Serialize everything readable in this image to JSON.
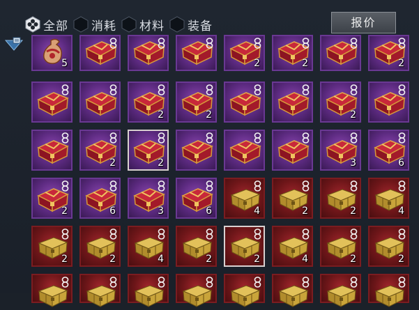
{
  "filters": [
    {
      "label": "全部",
      "selected": true
    },
    {
      "label": "消耗",
      "selected": false
    },
    {
      "label": "材料",
      "selected": false
    },
    {
      "label": "装备",
      "selected": false
    }
  ],
  "quote_button": "报价",
  "colors": {
    "purple_slot": "#5c2a80",
    "red_slot": "#6e1619",
    "gold_box": "#c9a43a"
  },
  "rows": [
    [
      {
        "item": "pouch",
        "rarity": "purple",
        "count": "5",
        "locked": false
      },
      {
        "item": "red-chest",
        "rarity": "purple",
        "count": "",
        "locked": true
      },
      {
        "item": "red-chest",
        "rarity": "purple",
        "count": "",
        "locked": true
      },
      {
        "item": "red-chest",
        "rarity": "purple",
        "count": "",
        "locked": true
      },
      {
        "item": "red-chest",
        "rarity": "purple",
        "count": "2",
        "locked": true
      },
      {
        "item": "red-chest",
        "rarity": "purple",
        "count": "2",
        "locked": true
      },
      {
        "item": "red-chest",
        "rarity": "purple",
        "count": "",
        "locked": true
      },
      {
        "item": "red-chest",
        "rarity": "purple",
        "count": "2",
        "locked": true
      }
    ],
    [
      {
        "item": "red-chest",
        "rarity": "purple",
        "count": "",
        "locked": true
      },
      {
        "item": "red-chest",
        "rarity": "purple",
        "count": "",
        "locked": true
      },
      {
        "item": "red-chest",
        "rarity": "purple",
        "count": "2",
        "locked": true
      },
      {
        "item": "red-chest",
        "rarity": "purple",
        "count": "2",
        "locked": true
      },
      {
        "item": "red-chest",
        "rarity": "purple",
        "count": "",
        "locked": true
      },
      {
        "item": "red-chest",
        "rarity": "purple",
        "count": "",
        "locked": true
      },
      {
        "item": "red-chest",
        "rarity": "purple",
        "count": "2",
        "locked": true
      },
      {
        "item": "red-chest",
        "rarity": "purple",
        "count": "",
        "locked": true
      }
    ],
    [
      {
        "item": "red-chest",
        "rarity": "purple",
        "count": "",
        "locked": true
      },
      {
        "item": "red-chest",
        "rarity": "purple",
        "count": "2",
        "locked": true
      },
      {
        "item": "red-chest",
        "rarity": "purple",
        "count": "2",
        "locked": true,
        "selected": true
      },
      {
        "item": "red-chest",
        "rarity": "purple",
        "count": "",
        "locked": true
      },
      {
        "item": "red-chest",
        "rarity": "purple",
        "count": "",
        "locked": true
      },
      {
        "item": "red-chest",
        "rarity": "purple",
        "count": "",
        "locked": true
      },
      {
        "item": "red-chest",
        "rarity": "purple",
        "count": "3",
        "locked": true
      },
      {
        "item": "red-chest",
        "rarity": "purple",
        "count": "6",
        "locked": true
      }
    ],
    [
      {
        "item": "red-chest",
        "rarity": "purple",
        "count": "2",
        "locked": true
      },
      {
        "item": "red-chest",
        "rarity": "purple",
        "count": "6",
        "locked": true
      },
      {
        "item": "red-chest",
        "rarity": "purple",
        "count": "3",
        "locked": true
      },
      {
        "item": "red-chest",
        "rarity": "purple",
        "count": "6",
        "locked": true
      },
      {
        "item": "gold-box",
        "rarity": "red",
        "count": "4",
        "locked": true
      },
      {
        "item": "gold-box",
        "rarity": "red",
        "count": "2",
        "locked": true
      },
      {
        "item": "gold-box",
        "rarity": "red",
        "count": "2",
        "locked": true
      },
      {
        "item": "gold-box",
        "rarity": "red",
        "count": "4",
        "locked": true
      }
    ],
    [
      {
        "item": "gold-box",
        "rarity": "red",
        "count": "2",
        "locked": true
      },
      {
        "item": "gold-box",
        "rarity": "red",
        "count": "2",
        "locked": true
      },
      {
        "item": "gold-box",
        "rarity": "red",
        "count": "4",
        "locked": true
      },
      {
        "item": "gold-box",
        "rarity": "red",
        "count": "2",
        "locked": true
      },
      {
        "item": "gold-box",
        "rarity": "red",
        "count": "2",
        "locked": true,
        "selected": true
      },
      {
        "item": "gold-box",
        "rarity": "red",
        "count": "4",
        "locked": true
      },
      {
        "item": "gold-box",
        "rarity": "red",
        "count": "2",
        "locked": true
      },
      {
        "item": "gold-box",
        "rarity": "red",
        "count": "2",
        "locked": true
      }
    ],
    [
      {
        "item": "gold-box",
        "rarity": "red",
        "count": "",
        "locked": true
      },
      {
        "item": "gold-box",
        "rarity": "red",
        "count": "",
        "locked": true
      },
      {
        "item": "gold-box",
        "rarity": "red",
        "count": "",
        "locked": true
      },
      {
        "item": "gold-box",
        "rarity": "red",
        "count": "",
        "locked": true
      },
      {
        "item": "gold-box",
        "rarity": "red",
        "count": "",
        "locked": true
      },
      {
        "item": "gold-box",
        "rarity": "red",
        "count": "",
        "locked": true
      },
      {
        "item": "gold-box",
        "rarity": "red",
        "count": "",
        "locked": true
      },
      {
        "item": "gold-box",
        "rarity": "red",
        "count": "",
        "locked": true
      }
    ]
  ]
}
